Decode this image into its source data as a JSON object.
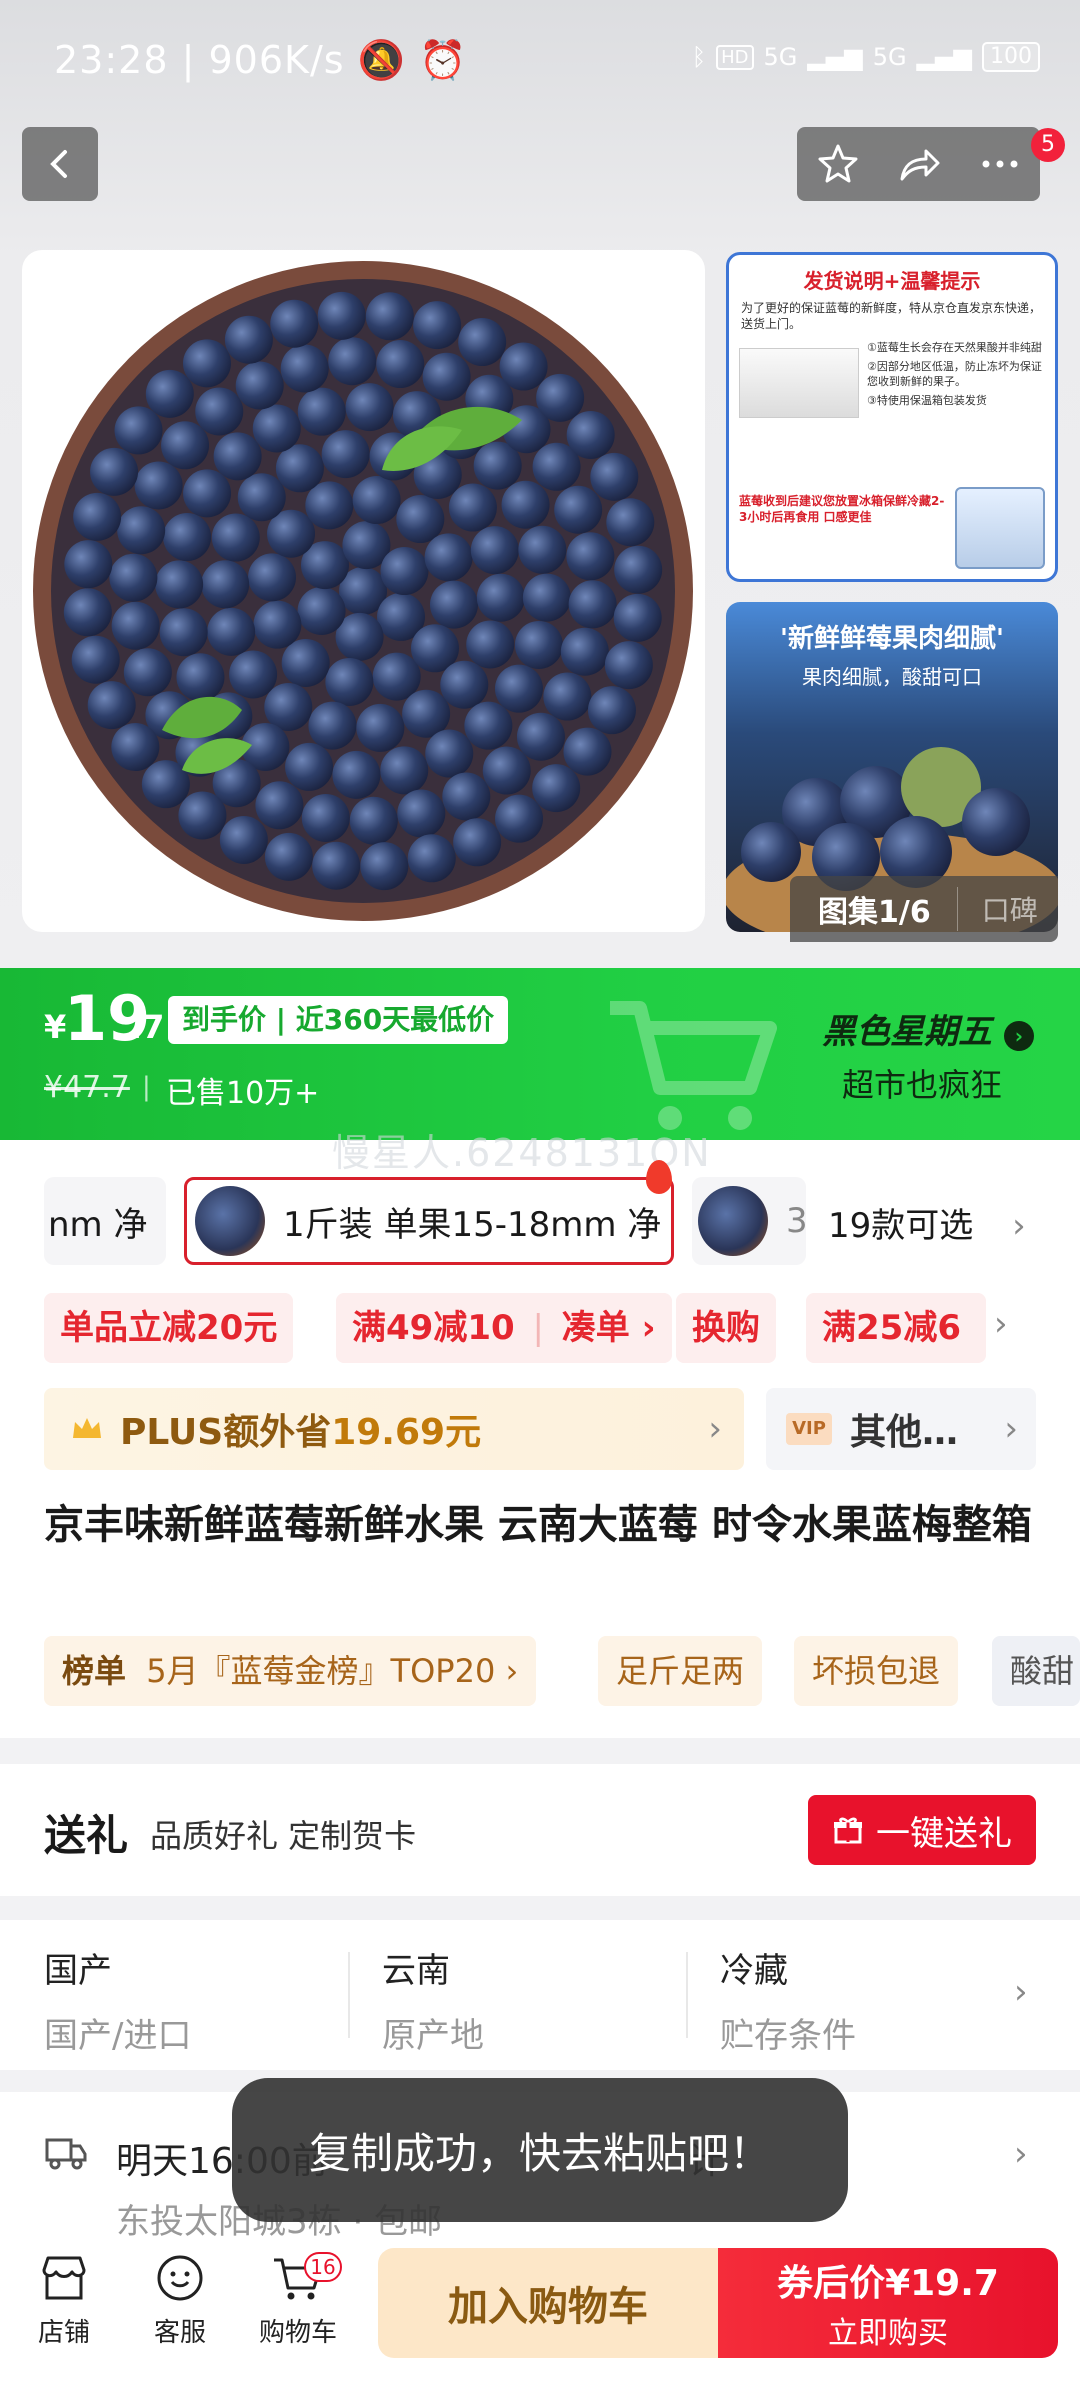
{
  "status_bar": {
    "time": "23:28",
    "speed": "906K/s",
    "network": "5G",
    "battery": "100"
  },
  "nav": {
    "badge": "5"
  },
  "gallery": {
    "side1_title": "发货说明+温馨提示",
    "side1_text": "为了更好的保证蓝莓的新鲜度，特从京仓直发京东快递，送货上门。",
    "side1_p1": "①蓝莓生长会存在天然果酸并非纯甜",
    "side1_p2": "②因部分地区低温，防止冻坏为保证您收到新鲜的果子。",
    "side1_p3": "③特使用保温箱包装发货",
    "side1_foot": "蓝莓收到后建议您放置冰箱保鲜冷藏2-3小时后再食用 口感更佳",
    "side2_title": "'新鲜鲜莓果肉细腻'",
    "side2_sub": "果肉细腻，酸甜可口",
    "counter": "图集1/6",
    "reviews": "口碑"
  },
  "price": {
    "symbol": "¥",
    "integer": "19",
    "decimal": ".7",
    "tag": "到手价 | 近360天最低价",
    "original": "¥47.7",
    "sold": "已售10万+",
    "promo_title": "黑色星期五",
    "promo_sub": "超市也疯狂"
  },
  "watermark": "慢星人.6248131ON",
  "specs": {
    "left": "nm 净",
    "selected": "1斤装 单果15-18mm 净",
    "right": "3",
    "count": "19款可选"
  },
  "coupons": [
    "单品立减20元",
    "满49减10",
    "凑单",
    "换购",
    "满25减6"
  ],
  "plus": {
    "prefix": "PLUS额外省",
    "amount": "19.69元"
  },
  "vip": {
    "badge": "VIP",
    "text": "其他…"
  },
  "title": "京丰味新鲜蓝莓新鲜水果 云南大蓝莓 时令水果蓝梅整箱",
  "tags": {
    "rank_label": "榜单",
    "rank_text": "5月『蓝莓金榜』TOP20",
    "t1": "足斤足两",
    "t2": "坏损包退",
    "t3": "酸甜"
  },
  "gift": {
    "title": "送礼",
    "sub": "品质好礼 定制贺卡",
    "button": "一键送礼"
  },
  "attributes": [
    {
      "value": "国产",
      "label": "国产/进口"
    },
    {
      "value": "云南",
      "label": "原产地"
    },
    {
      "value": "冷藏",
      "label": "贮存条件"
    }
  ],
  "delivery": {
    "text": "明天16:00前",
    "text_tail": "计",
    "address": "东投太阳城3栋 · 包邮"
  },
  "toast": "复制成功，快去粘贴吧！",
  "bottom": {
    "store": "店铺",
    "service": "客服",
    "cart": "购物车",
    "cart_count": "16",
    "add_cart": "加入购物车",
    "buy_l1": "券后价¥19.7",
    "buy_l2": "立即购买"
  }
}
